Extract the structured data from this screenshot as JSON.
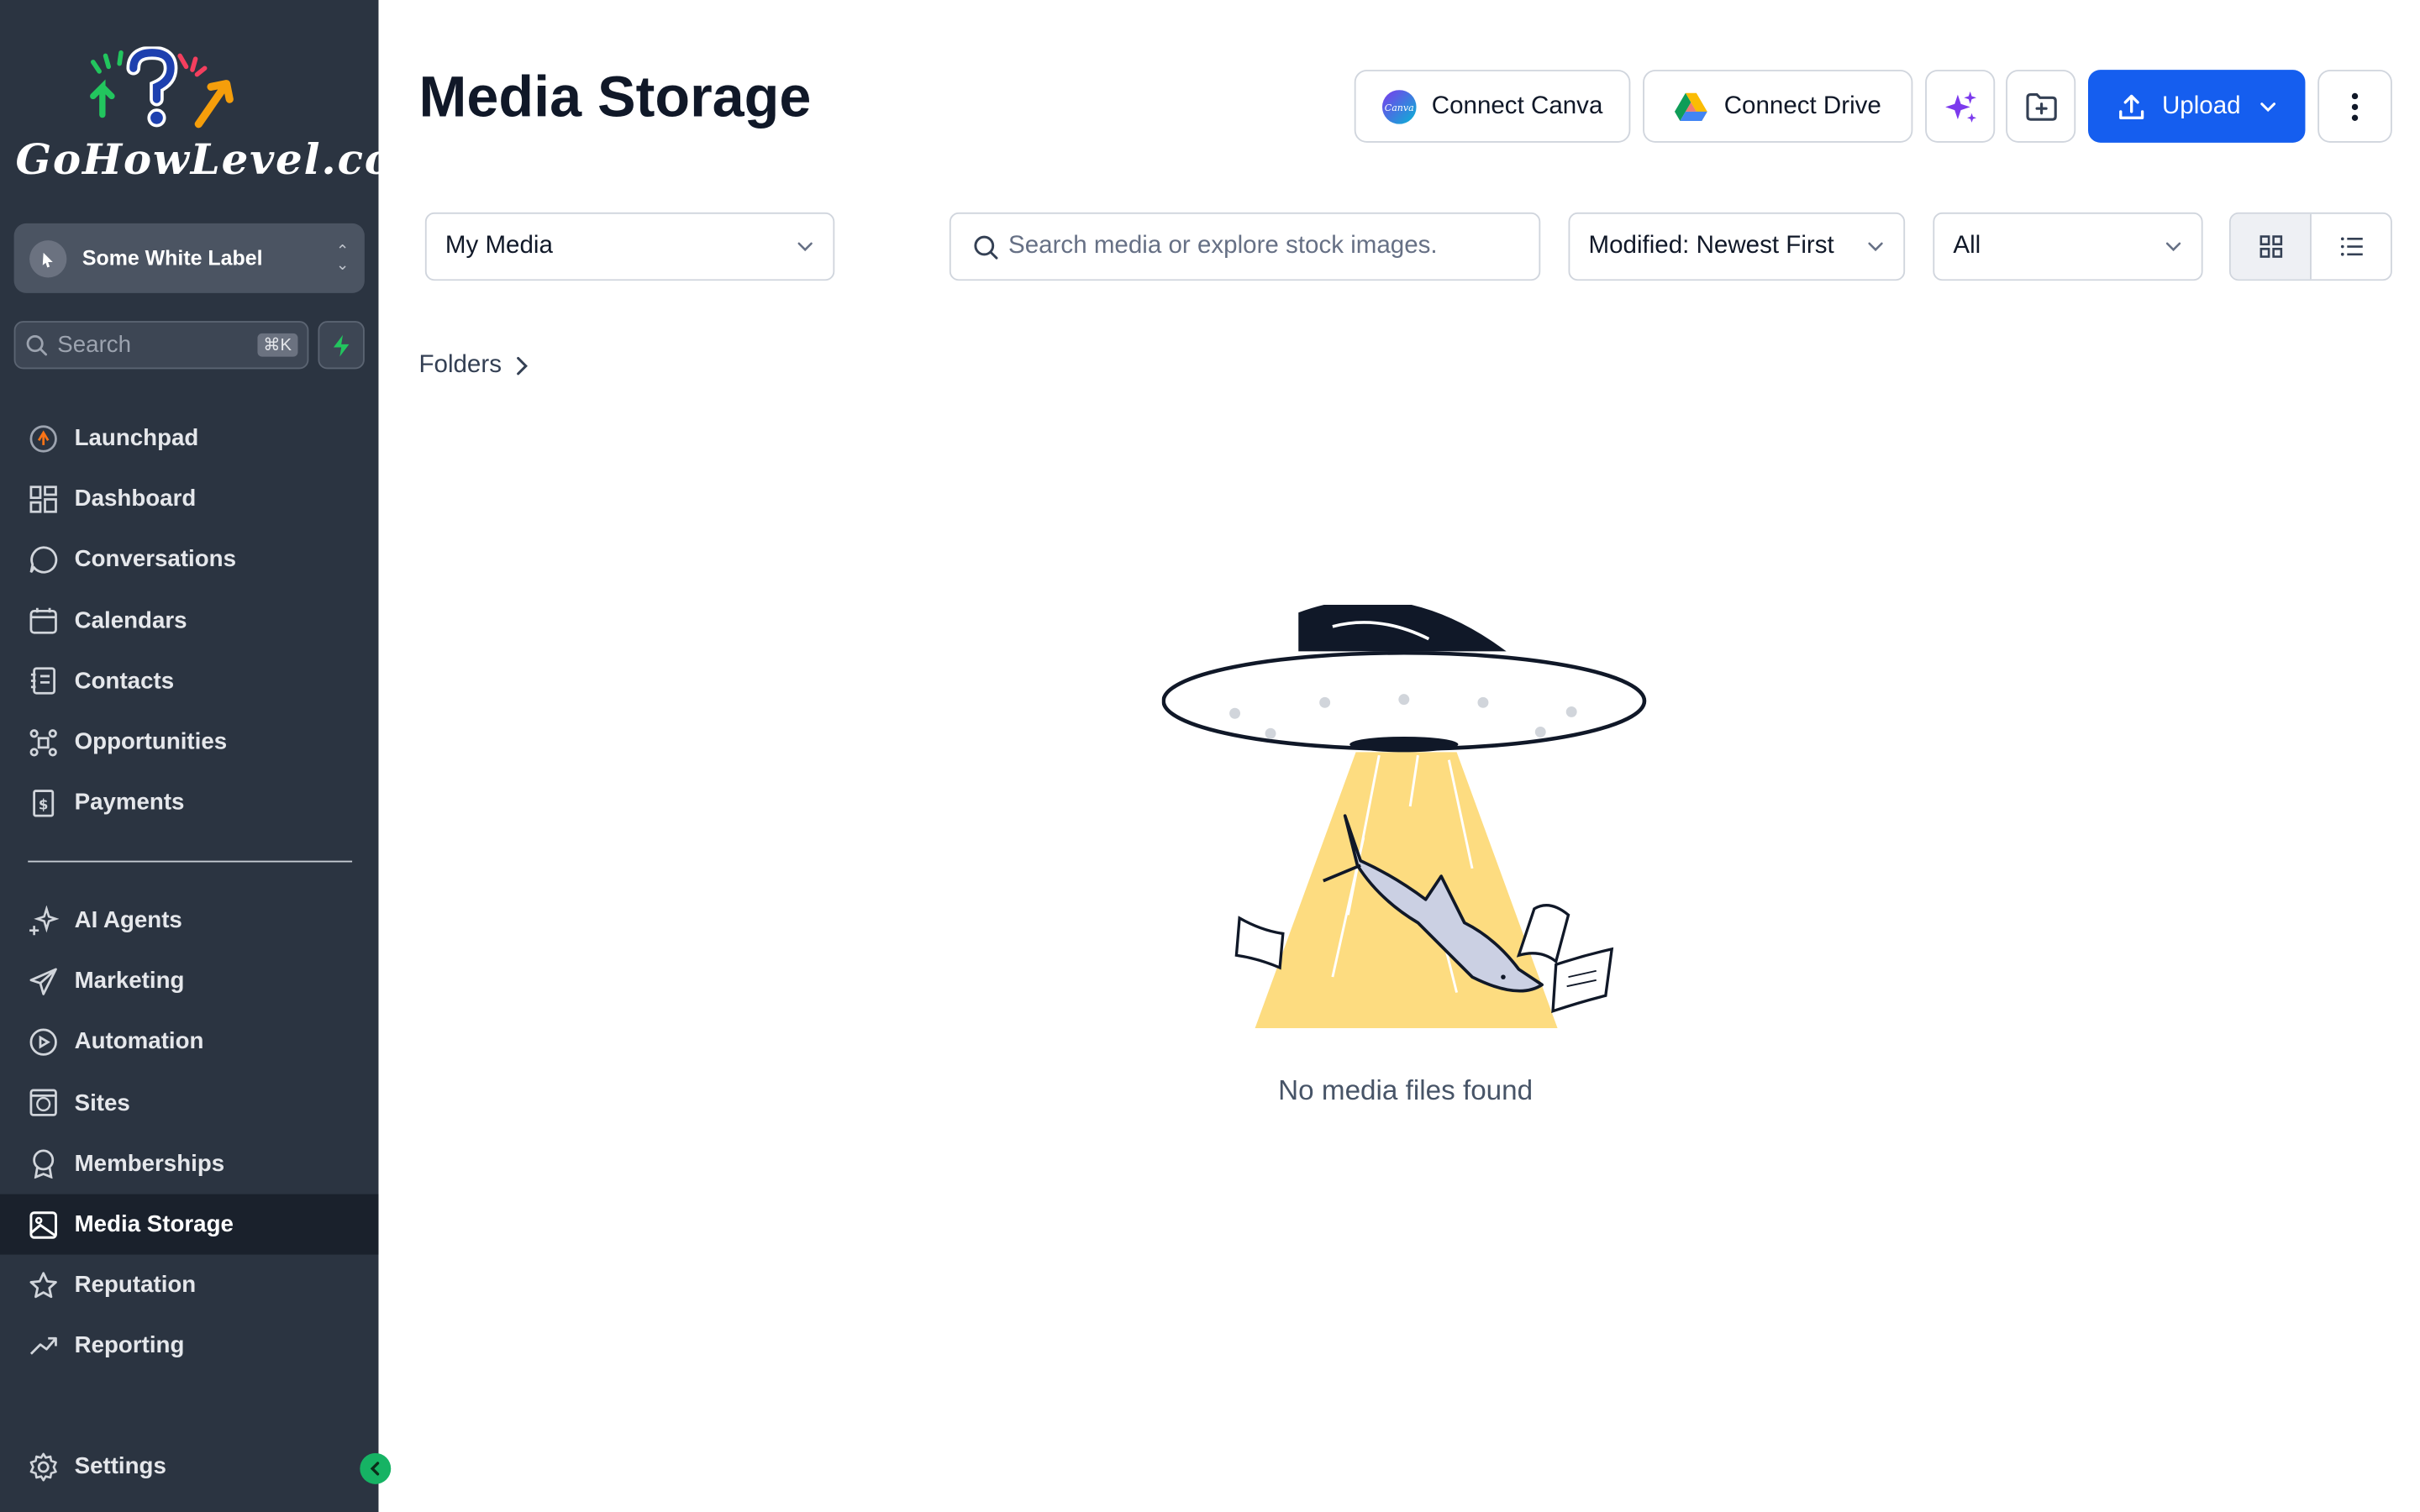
{
  "brand": {
    "logo_text": "GoHowLevel.com"
  },
  "location_switcher": {
    "label": "Some White Label"
  },
  "sidebar_search": {
    "placeholder": "Search",
    "shortcut": "⌘K"
  },
  "nav_primary": [
    {
      "label": "Launchpad",
      "icon": "launchpad-icon"
    },
    {
      "label": "Dashboard",
      "icon": "dashboard-icon"
    },
    {
      "label": "Conversations",
      "icon": "chat-icon"
    },
    {
      "label": "Calendars",
      "icon": "calendar-icon"
    },
    {
      "label": "Contacts",
      "icon": "contacts-icon"
    },
    {
      "label": "Opportunities",
      "icon": "opportunities-icon"
    },
    {
      "label": "Payments",
      "icon": "payments-icon"
    }
  ],
  "nav_secondary": [
    {
      "label": "AI Agents",
      "icon": "sparkle-icon"
    },
    {
      "label": "Marketing",
      "icon": "send-icon"
    },
    {
      "label": "Automation",
      "icon": "play-circle-icon"
    },
    {
      "label": "Sites",
      "icon": "globe-icon"
    },
    {
      "label": "Memberships",
      "icon": "badge-icon"
    },
    {
      "label": "Media Storage",
      "icon": "image-icon",
      "active": true
    },
    {
      "label": "Reputation",
      "icon": "star-icon"
    },
    {
      "label": "Reporting",
      "icon": "trend-icon"
    }
  ],
  "nav_bottom": {
    "label": "Settings",
    "icon": "gear-icon"
  },
  "header": {
    "title": "Media Storage",
    "connect_canva": "Connect Canva",
    "connect_drive": "Connect Drive",
    "upload": "Upload"
  },
  "filters": {
    "source": "My Media",
    "search_placeholder": "Search media or explore stock images.",
    "sort": "Modified: Newest First",
    "type": "All"
  },
  "breadcrumb": {
    "folders": "Folders"
  },
  "empty_state": {
    "message": "No media files found"
  },
  "colors": {
    "sidebar_bg": "#2b3441",
    "sidebar_active": "#1a212c",
    "primary": "#155eef",
    "accent_green": "#16b364",
    "ufo_beam": "#fddc80"
  }
}
